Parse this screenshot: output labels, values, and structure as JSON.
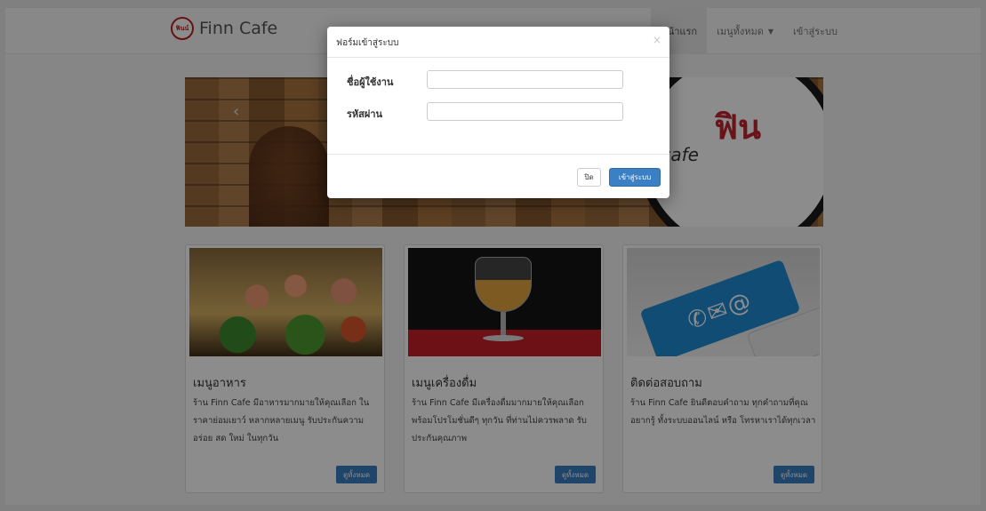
{
  "navbar": {
    "brand_logo_text": "ฟินน์",
    "brand": "Finn Cafe",
    "links": [
      {
        "label": "หน้าแรก"
      },
      {
        "label": "เมนูทั้งหมด"
      },
      {
        "label": "เข้าสู่ระบบ"
      }
    ]
  },
  "carousel": {
    "prev_icon": "‹",
    "next_icon": "›",
    "sign_text": "ฟิน",
    "sign_sub": "cafe"
  },
  "cards": [
    {
      "title": "เมนูอาหาร",
      "text": "ร้าน Finn Cafe มีอาหารมากมายให้คุณเลือก ในราคาย่อมเยาว์ หลากหลายเมนู รับประกันความอร่อย สด ใหม่ ในทุกวัน",
      "button": "ดูทั้งหมด"
    },
    {
      "title": "เมนูเครื่องดื่ม",
      "text": "ร้าน Finn Cafe มีเครื่องดื่มมากมายให้คุณเลือก พร้อมโปรโมชั่นดีๆ ทุกวัน ที่ท่านไม่ควรพลาด รับประกันคุณภาพ",
      "button": "ดูทั้งหมด"
    },
    {
      "title": "ติดต่อสอบถาม",
      "text": "ร้าน Finn Cafe ยินดีตอบคำถาม ทุกคำถามที่คุณอยากรู้ ทั้งระบบออนไลน์ หรือ โทรหาเราได้ทุกเวลา",
      "button": "ดูทั้งหมด"
    }
  ],
  "modal": {
    "title": "ฟอร์มเข้าสู่ระบบ",
    "close_icon": "×",
    "username_label": "ชื่อผู้ใช้งาน",
    "username_value": "",
    "password_label": "รหัสผ่าน",
    "password_value": "",
    "close_button": "ปิด",
    "login_button": "เข้าสู่ระบบ"
  }
}
